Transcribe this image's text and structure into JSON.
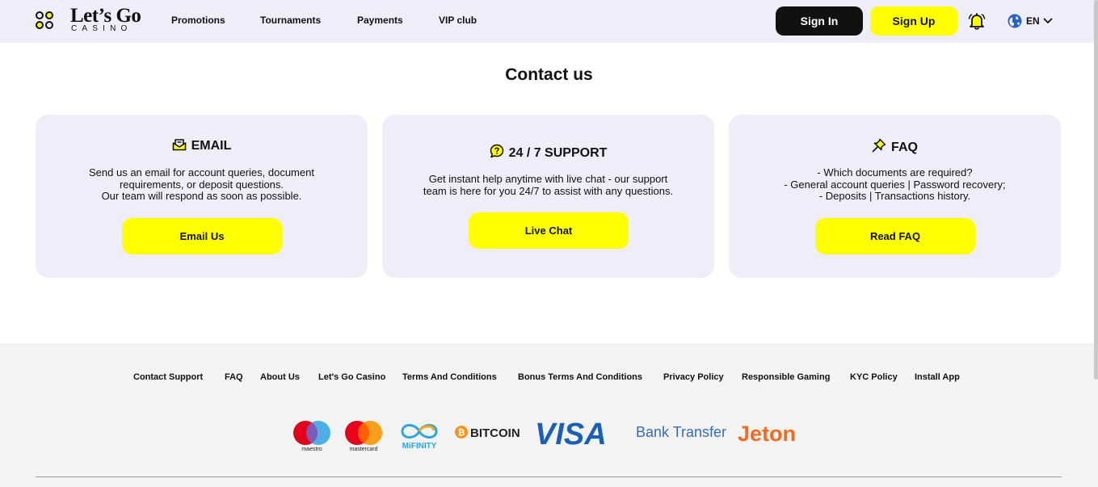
{
  "header": {
    "logo_title": "Let’s Go",
    "logo_subtitle": "CASINO",
    "nav": [
      "Promotions",
      "Tournaments",
      "Payments",
      "VIP club"
    ],
    "signin_label": "Sign In",
    "signup_label": "Sign Up",
    "language": "EN"
  },
  "main": {
    "title": "Contact us",
    "cards": [
      {
        "heading": "EMAIL",
        "icon": "email-icon",
        "text": "Send us an email for account queries, document\nrequirements, or deposit questions.\nOur team will respond as soon as possible.",
        "button": "Email Us"
      },
      {
        "heading": "24 / 7 SUPPORT",
        "icon": "chat-support-icon",
        "text": "Get instant help anytime with live chat - our support\nteam is here for you 24/7 to assist with any questions.",
        "button": "Live Chat"
      },
      {
        "heading": "FAQ",
        "icon": "pin-icon",
        "text": "- Which documents are required?\n- General account queries | Password recovery;\n- Deposits | Transactions history.",
        "button": "Read FAQ"
      }
    ]
  },
  "footer": {
    "links": [
      "Contact Support",
      "FAQ",
      "About Us",
      "Let's Go Casino",
      "Terms And Conditions",
      "Bonus Terms And Conditions",
      "Privacy Policy",
      "Responsible Gaming",
      "KYC Policy",
      "Install App"
    ],
    "payments": {
      "maestro": "maestro",
      "mastercard": "mastercard",
      "mifinity": "MiFINITY",
      "bitcoin": "BITCOIN",
      "visa": "VISA",
      "bank_transfer": "Bank Transfer",
      "jeton": "Jeton"
    }
  },
  "colors": {
    "accent_yellow": "#ffff00",
    "panel_lavender": "#efedf8",
    "dark": "#111111"
  }
}
